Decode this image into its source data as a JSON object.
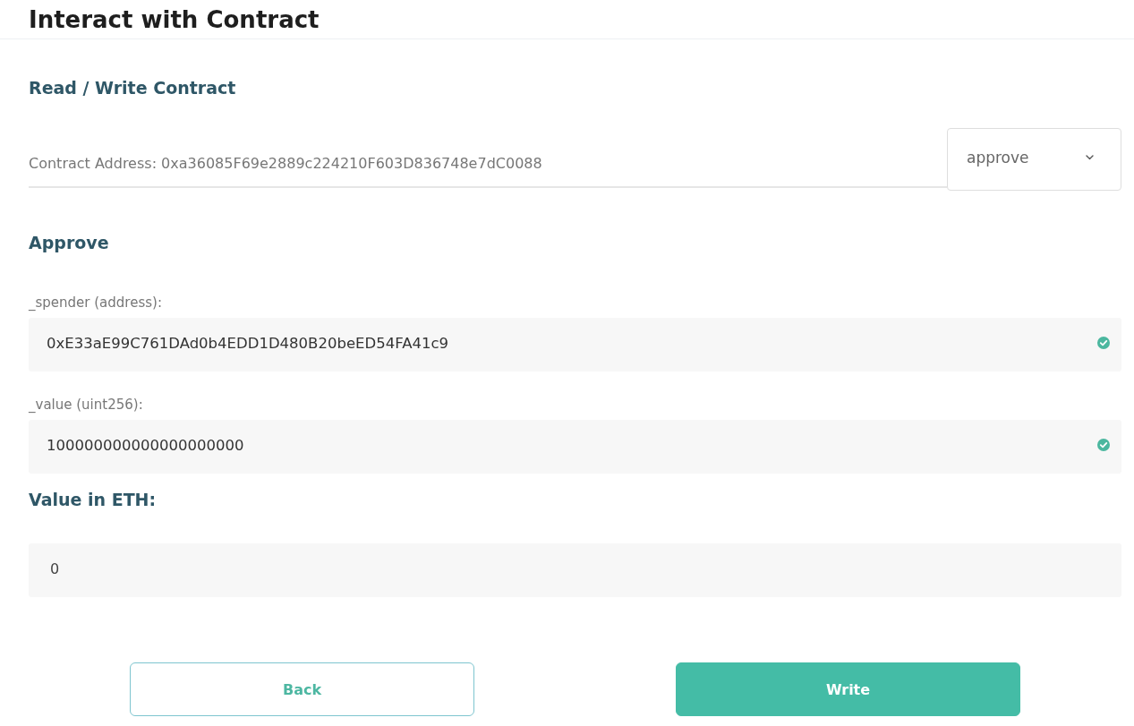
{
  "page": {
    "title": "Interact with Contract"
  },
  "section": {
    "heading": "Read / Write Contract"
  },
  "contract": {
    "address_text": "Contract Address: 0xa36085F69e2889c224210F603D836748e7dC0088"
  },
  "method_select": {
    "value": "approve"
  },
  "function": {
    "heading": "Approve",
    "params": [
      {
        "label": "_spender (address):",
        "value": "0xE33aE99C761DAd0b4EDD1D480B20beED54FA41c9",
        "valid": true
      },
      {
        "label": "_value (uint256):",
        "value": "100000000000000000000",
        "valid": true
      }
    ]
  },
  "eth_value": {
    "label": "Value in ETH:",
    "value": "0"
  },
  "buttons": [
    {
      "label": "Back",
      "kind": "outline"
    },
    {
      "label": "Write",
      "kind": "primary"
    }
  ]
}
